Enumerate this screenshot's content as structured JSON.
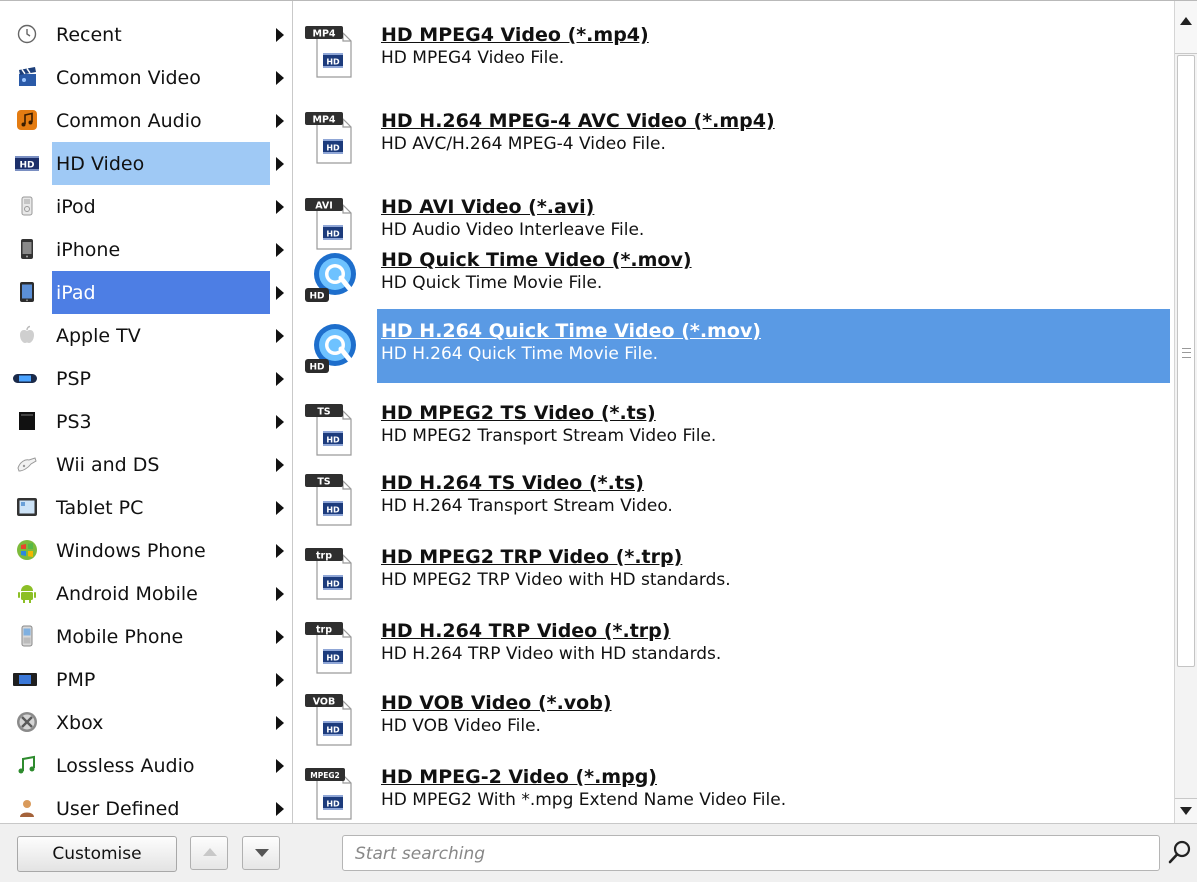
{
  "categories": [
    {
      "label": "Recent",
      "icon": "clock-icon"
    },
    {
      "label": "Common Video",
      "icon": "clapperboard-icon"
    },
    {
      "label": "Common Audio",
      "icon": "music-note-icon"
    },
    {
      "label": "HD Video",
      "icon": "hd-badge-icon"
    },
    {
      "label": "iPod",
      "icon": "ipod-icon"
    },
    {
      "label": "iPhone",
      "icon": "iphone-icon"
    },
    {
      "label": "iPad",
      "icon": "ipad-icon"
    },
    {
      "label": "Apple TV",
      "icon": "apple-tv-icon"
    },
    {
      "label": "PSP",
      "icon": "psp-icon"
    },
    {
      "label": "PS3",
      "icon": "ps3-icon"
    },
    {
      "label": "Wii and DS",
      "icon": "wii-controller-icon"
    },
    {
      "label": "Tablet PC",
      "icon": "tablet-icon"
    },
    {
      "label": "Windows Phone",
      "icon": "windows-logo-icon"
    },
    {
      "label": "Android Mobile",
      "icon": "android-icon"
    },
    {
      "label": "Mobile Phone",
      "icon": "mobile-phone-icon"
    },
    {
      "label": "PMP",
      "icon": "pmp-icon"
    },
    {
      "label": "Xbox",
      "icon": "xbox-icon"
    },
    {
      "label": "Lossless Audio",
      "icon": "lossless-audio-icon"
    },
    {
      "label": "User Defined",
      "icon": "user-icon"
    }
  ],
  "formats": [
    {
      "title": "HD MPEG4 Video (*.mp4)",
      "desc": "HD MPEG4 Video File.",
      "badge": "MP4"
    },
    {
      "title": "HD H.264 MPEG-4 AVC Video (*.mp4)",
      "desc": "HD AVC/H.264 MPEG-4 Video File.",
      "badge": "MP4"
    },
    {
      "title": "HD AVI Video (*.avi)",
      "desc": "HD Audio Video Interleave File.",
      "badge": "AVI"
    },
    {
      "title": "HD Quick Time Video (*.mov)",
      "desc": "HD Quick Time Movie File.",
      "badge": "HD"
    },
    {
      "title": "HD H.264 Quick Time Video (*.mov)",
      "desc": "HD H.264 Quick Time Movie File.",
      "badge": "HD"
    },
    {
      "title": "HD MPEG2 TS Video (*.ts)",
      "desc": "HD MPEG2 Transport Stream Video File.",
      "badge": "TS"
    },
    {
      "title": "HD H.264 TS Video (*.ts)",
      "desc": "HD H.264 Transport Stream Video.",
      "badge": "TS"
    },
    {
      "title": "HD MPEG2 TRP Video (*.trp)",
      "desc": "HD MPEG2 TRP Video with HD standards.",
      "badge": "trp"
    },
    {
      "title": "HD H.264 TRP Video (*.trp)",
      "desc": "HD H.264 TRP Video with HD standards.",
      "badge": "trp"
    },
    {
      "title": "HD VOB Video (*.vob)",
      "desc": "HD VOB Video File.",
      "badge": "VOB"
    },
    {
      "title": "HD MPEG-2 Video (*.mpg)",
      "desc": "HD MPEG2 With *.mpg Extend Name Video File.",
      "badge": "MPEG2"
    }
  ],
  "doc_badge": "HD",
  "qt_badge": "HD",
  "toolbar": {
    "customise_label": "Customise",
    "search_placeholder": "Start searching"
  },
  "colors": {
    "category_hover": "#9fc9f5",
    "category_selected": "#4d7ee4",
    "format_selected": "#5a9ae4"
  }
}
